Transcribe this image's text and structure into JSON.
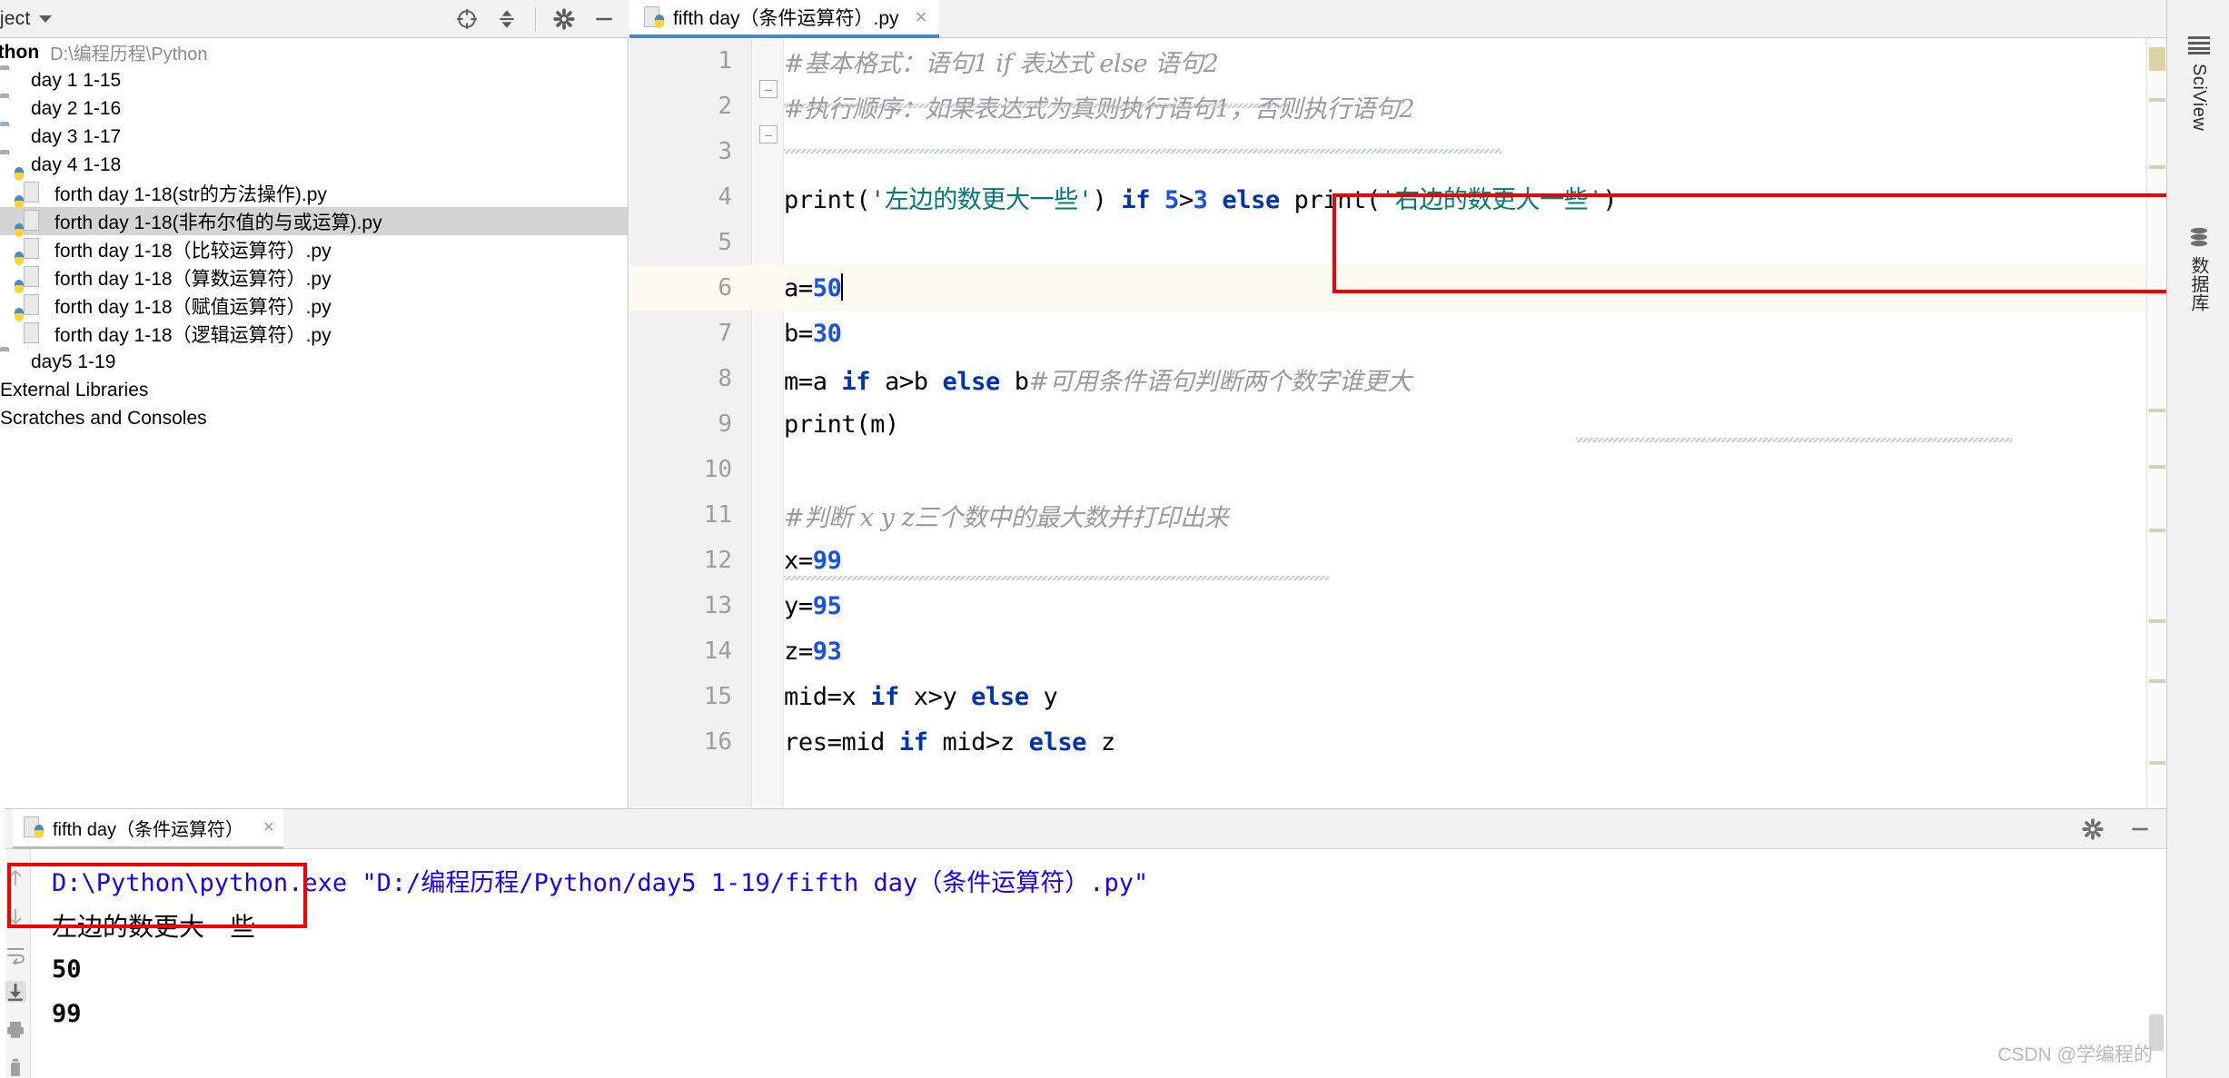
{
  "project_panel": {
    "title": "oject",
    "caret": "chevron-down-icon",
    "actions": [
      "locate-icon",
      "collapse-all-icon",
      "settings-icon",
      "hide-icon"
    ],
    "root": {
      "name": "Python",
      "path": "D:\\编程历程\\Python"
    },
    "items": [
      {
        "label": "day 1 1-15",
        "type": "folder",
        "selected": false
      },
      {
        "label": "day 2 1-16",
        "type": "folder",
        "selected": false
      },
      {
        "label": "day 3 1-17",
        "type": "folder",
        "selected": false
      },
      {
        "label": "day 4 1-18",
        "type": "folder",
        "selected": false
      },
      {
        "label": "forth day 1-18(str的方法操作).py",
        "type": "file",
        "selected": false
      },
      {
        "label": "forth day 1-18(非布尔值的与或运算).py",
        "type": "file",
        "selected": true
      },
      {
        "label": "forth day 1-18（比较运算符）.py",
        "type": "file",
        "selected": false
      },
      {
        "label": "forth day 1-18（算数运算符）.py",
        "type": "file",
        "selected": false
      },
      {
        "label": "forth day 1-18（赋值运算符）.py",
        "type": "file",
        "selected": false
      },
      {
        "label": "forth day 1-18（逻辑运算符）.py",
        "type": "file",
        "selected": false
      },
      {
        "label": "day5 1-19",
        "type": "folder",
        "selected": false
      },
      {
        "label": "External Libraries",
        "type": "node",
        "selected": false
      },
      {
        "label": "Scratches and Consoles",
        "type": "node",
        "selected": false
      }
    ]
  },
  "editor": {
    "tab": {
      "label": "fifth day（条件运算符）.py",
      "icon": "python-file-icon",
      "close": "×"
    },
    "current_line": 6,
    "lines": [
      {
        "n": "1",
        "text": "#基本格式：语句1 if 表达式 else 语句2"
      },
      {
        "n": "2",
        "text": "#执行顺序：如果表达式为真则执行语句1，否则执行语句2"
      },
      {
        "n": "3",
        "text": ""
      },
      {
        "n": "4",
        "text": "print('左边的数更大一些') if 5>3 else print('右边的数更大一些')"
      },
      {
        "n": "5",
        "text": ""
      },
      {
        "n": "6",
        "text": "a=50"
      },
      {
        "n": "7",
        "text": "b=30"
      },
      {
        "n": "8",
        "text": "m=a if a>b else b#可用条件语句判断两个数字谁更大"
      },
      {
        "n": "9",
        "text": "print(m)"
      },
      {
        "n": "10",
        "text": ""
      },
      {
        "n": "11",
        "text": "#判断 x y z三个数中的最大数并打印出来"
      },
      {
        "n": "12",
        "text": "x=99"
      },
      {
        "n": "13",
        "text": "y=95"
      },
      {
        "n": "14",
        "text": "z=93"
      },
      {
        "n": "15",
        "text": "mid=x if x>y else y"
      },
      {
        "n": "16",
        "text": "res=mid if mid>z else z"
      }
    ]
  },
  "console": {
    "tab": {
      "label": "fifth day（条件运算符）",
      "icon": "python-file-icon",
      "close": "×"
    },
    "actions": [
      "settings-icon",
      "hide-icon"
    ],
    "left_tools": [
      "scroll-up-icon",
      "scroll-down-icon",
      "soft-wrap-icon",
      "scroll-to-end-icon",
      "print-icon",
      "trash-icon"
    ],
    "command": "D:\\Python\\python.exe \"D:/编程历程/Python/day5 1-19/fifth day（条件运算符）.py\"",
    "output": [
      "左边的数更大一些",
      "50",
      "99"
    ]
  },
  "right_strip": {
    "items": [
      {
        "label": "SciView",
        "icon": "sciview-grid-icon"
      },
      {
        "label": "数据库",
        "icon": "database-icon"
      }
    ]
  },
  "annotations": {
    "box_color": "#f40000",
    "boxes": [
      "code-line-4-highlight-box",
      "console-output-highlight-box"
    ]
  },
  "watermark": "CSDN @学编程的",
  "colors": {
    "accent": "#4a86c8",
    "keyword": "#0033b3",
    "number": "#1750eb",
    "string": "#007a7a",
    "comment": "#9a9a9a",
    "selection": "#d4d4d4",
    "current_line": "#fcfbf2"
  }
}
